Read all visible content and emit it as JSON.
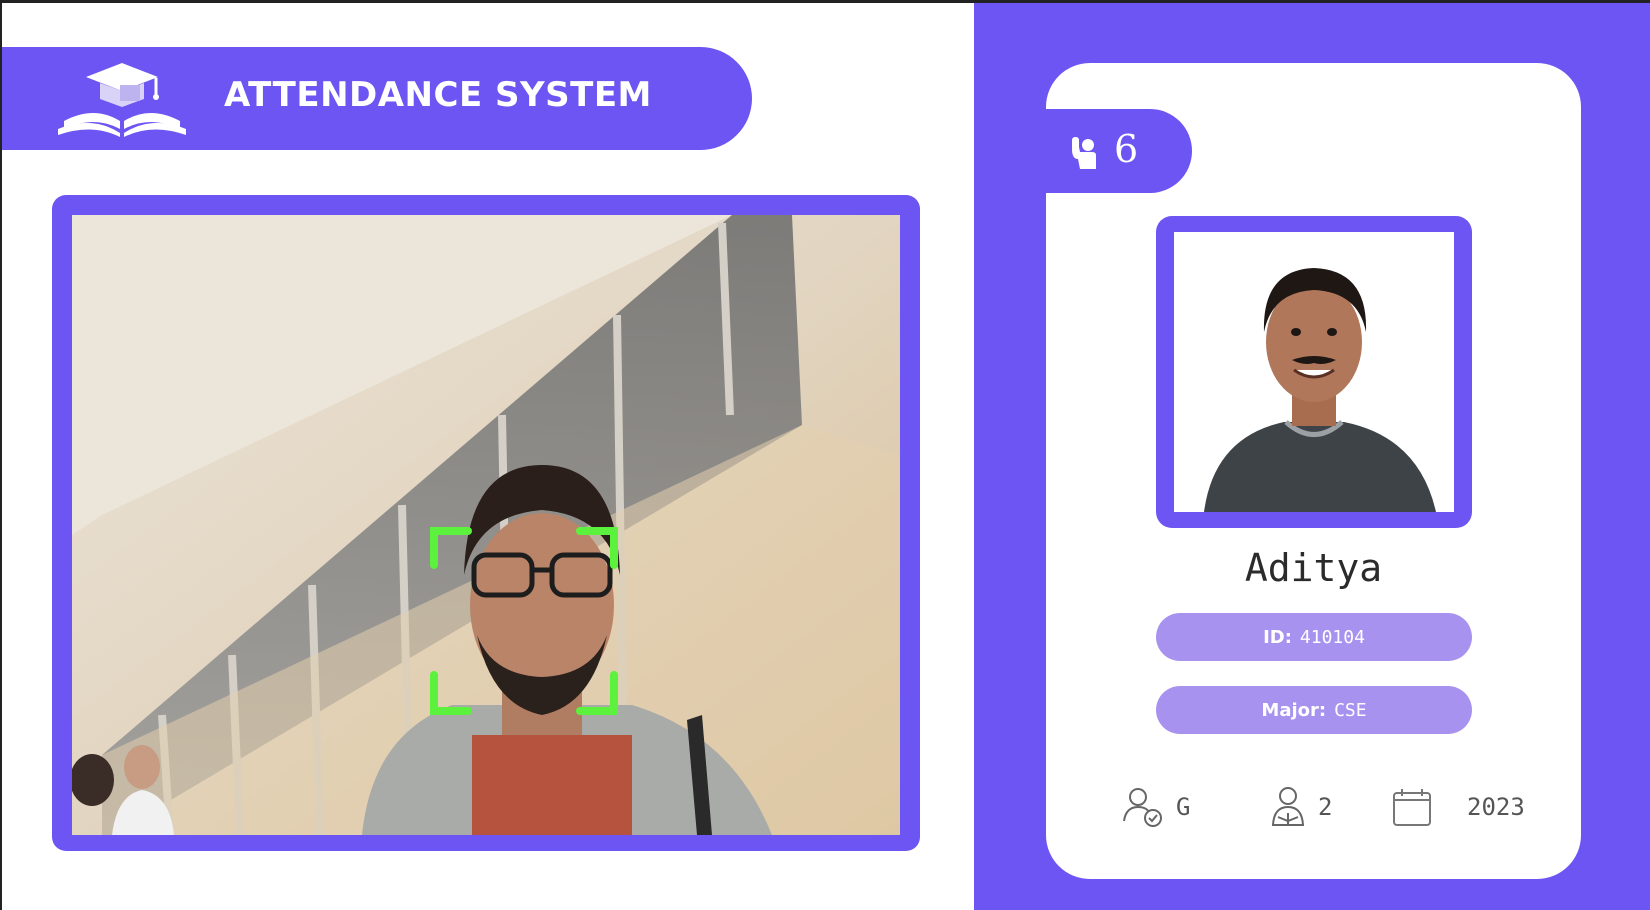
{
  "theme": {
    "accent": "#6c55f2",
    "pill": "#a892f0",
    "face_box": "#5cf13c"
  },
  "header": {
    "logo_icon": "graduation-cap-book-icon",
    "title": "ATTENDANCE SYSTEM"
  },
  "camera": {
    "feed_label": "camera-feed",
    "face_detection": "detected"
  },
  "student": {
    "attendance_icon": "raised-hand-icon",
    "total_attendance": "6",
    "name": "Aditya",
    "id_label": "ID:",
    "id_value": "410104",
    "major_label": "Major:",
    "major_value": "CSE",
    "standing_icon": "user-check-icon",
    "standing": "G",
    "year_icon": "student-icon",
    "year": "2",
    "starting_year_icon": "calendar-icon",
    "starting_year": "2023"
  }
}
